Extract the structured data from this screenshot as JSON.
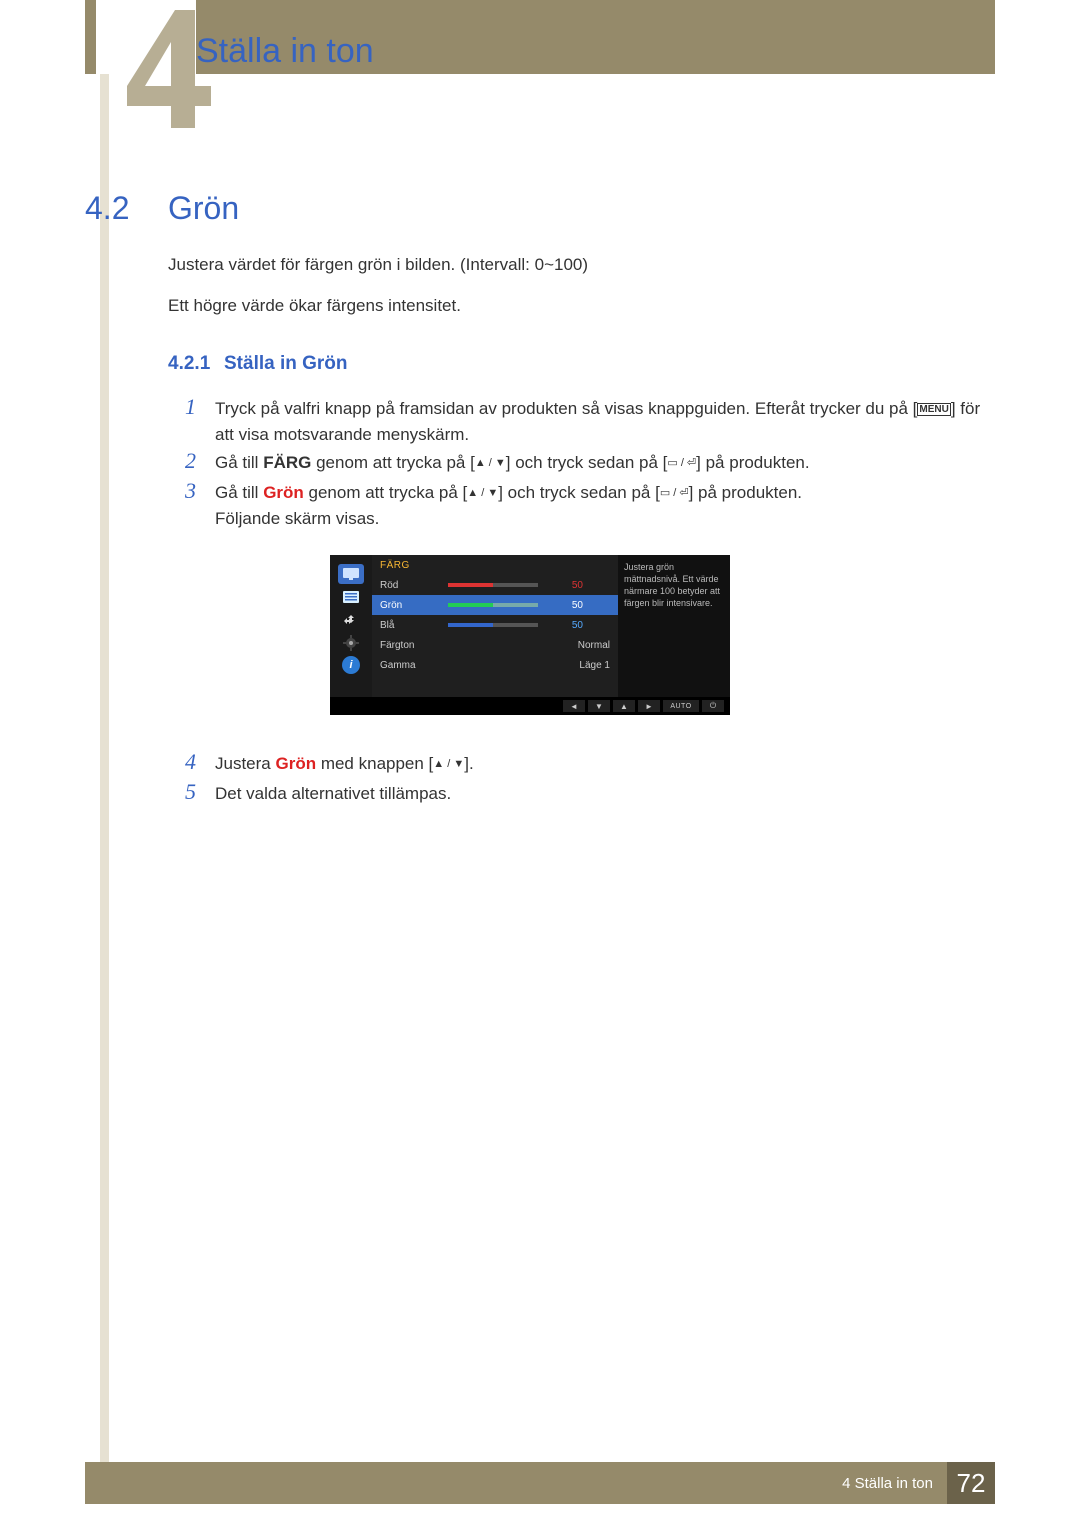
{
  "header": {
    "chapter_title": "Ställa in ton"
  },
  "section": {
    "number": "4.2",
    "title": "Grön"
  },
  "intro": {
    "l1": "Justera värdet för färgen grön i bilden. (Intervall: 0~100)",
    "l2": "Ett högre värde ökar färgens intensitet."
  },
  "subsection": {
    "number": "4.2.1",
    "title": "Ställa in Grön"
  },
  "steps": {
    "s1": {
      "n": "1",
      "t1": "Tryck på valfri knapp på framsidan av produkten så visas knappguiden. Efteråt trycker du på [",
      "menu": "MENU",
      "t2": "] för att visa motsvarande menyskärm."
    },
    "s2": {
      "n": "2",
      "a": "Gå till ",
      "kw": "FÄRG",
      "b": " genom att trycka på [",
      "c": "] och tryck sedan på [",
      "d": "] på produkten."
    },
    "s3": {
      "n": "3",
      "a": "Gå till ",
      "kw": "Grön",
      "b": " genom att trycka på [",
      "c": "] och tryck sedan på [",
      "d": "] på produkten.",
      "e": "Följande skärm visas."
    },
    "s4": {
      "n": "4",
      "a": "Justera ",
      "kw": "Grön",
      "b": " med knappen [",
      "c": "]."
    },
    "s5": {
      "n": "5",
      "a": "Det valda alternativet tillämpas."
    }
  },
  "osd": {
    "title": "FÄRG",
    "rows": {
      "red": {
        "label": "Röd",
        "val": "50"
      },
      "green": {
        "label": "Grön",
        "val": "50"
      },
      "blue": {
        "label": "Blå",
        "val": "50"
      },
      "tone": {
        "label": "Färgton",
        "val": "Normal"
      },
      "gamma": {
        "label": "Gamma",
        "val": "Läge 1"
      }
    },
    "help": "Justera grön mättnadsnivå. Ett värde närmare 100 betyder att färgen blir intensivare.",
    "nav_auto": "AUTO"
  },
  "footer": {
    "text": "4 Ställa in ton",
    "page": "72"
  }
}
